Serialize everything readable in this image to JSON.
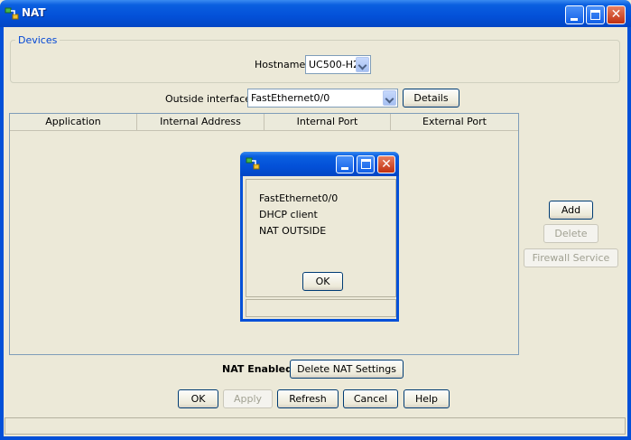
{
  "window": {
    "title": "NAT",
    "minimize_label": "_",
    "maximize_label": "□",
    "close_label": "✕"
  },
  "devices": {
    "legend": "Devices",
    "hostname_label": "Hostname:",
    "hostname_value": "UC500-H2"
  },
  "outside": {
    "label": "Outside interface:",
    "value": "FastEthernet0/0",
    "details_button": "Details"
  },
  "table": {
    "columns": [
      "Application",
      "Internal Address",
      "Internal Port",
      "External Port"
    ],
    "rows": []
  },
  "side_buttons": {
    "add": "Add",
    "delete": "Delete",
    "firewall": "Firewall Service"
  },
  "nat": {
    "status_label": "NAT Enabled",
    "delete_settings_button": "Delete NAT Settings"
  },
  "footer_buttons": {
    "ok": "OK",
    "apply": "Apply",
    "refresh": "Refresh",
    "cancel": "Cancel",
    "help": "Help"
  },
  "dialog": {
    "lines": [
      "FastEthernet0/0",
      "DHCP client",
      "NAT OUTSIDE"
    ],
    "ok_button": "OK"
  },
  "colors": {
    "title_bar": "#0350d8",
    "window_bg": "#ece9d8",
    "legend_text": "#0046d5",
    "close_button": "#c03010"
  }
}
